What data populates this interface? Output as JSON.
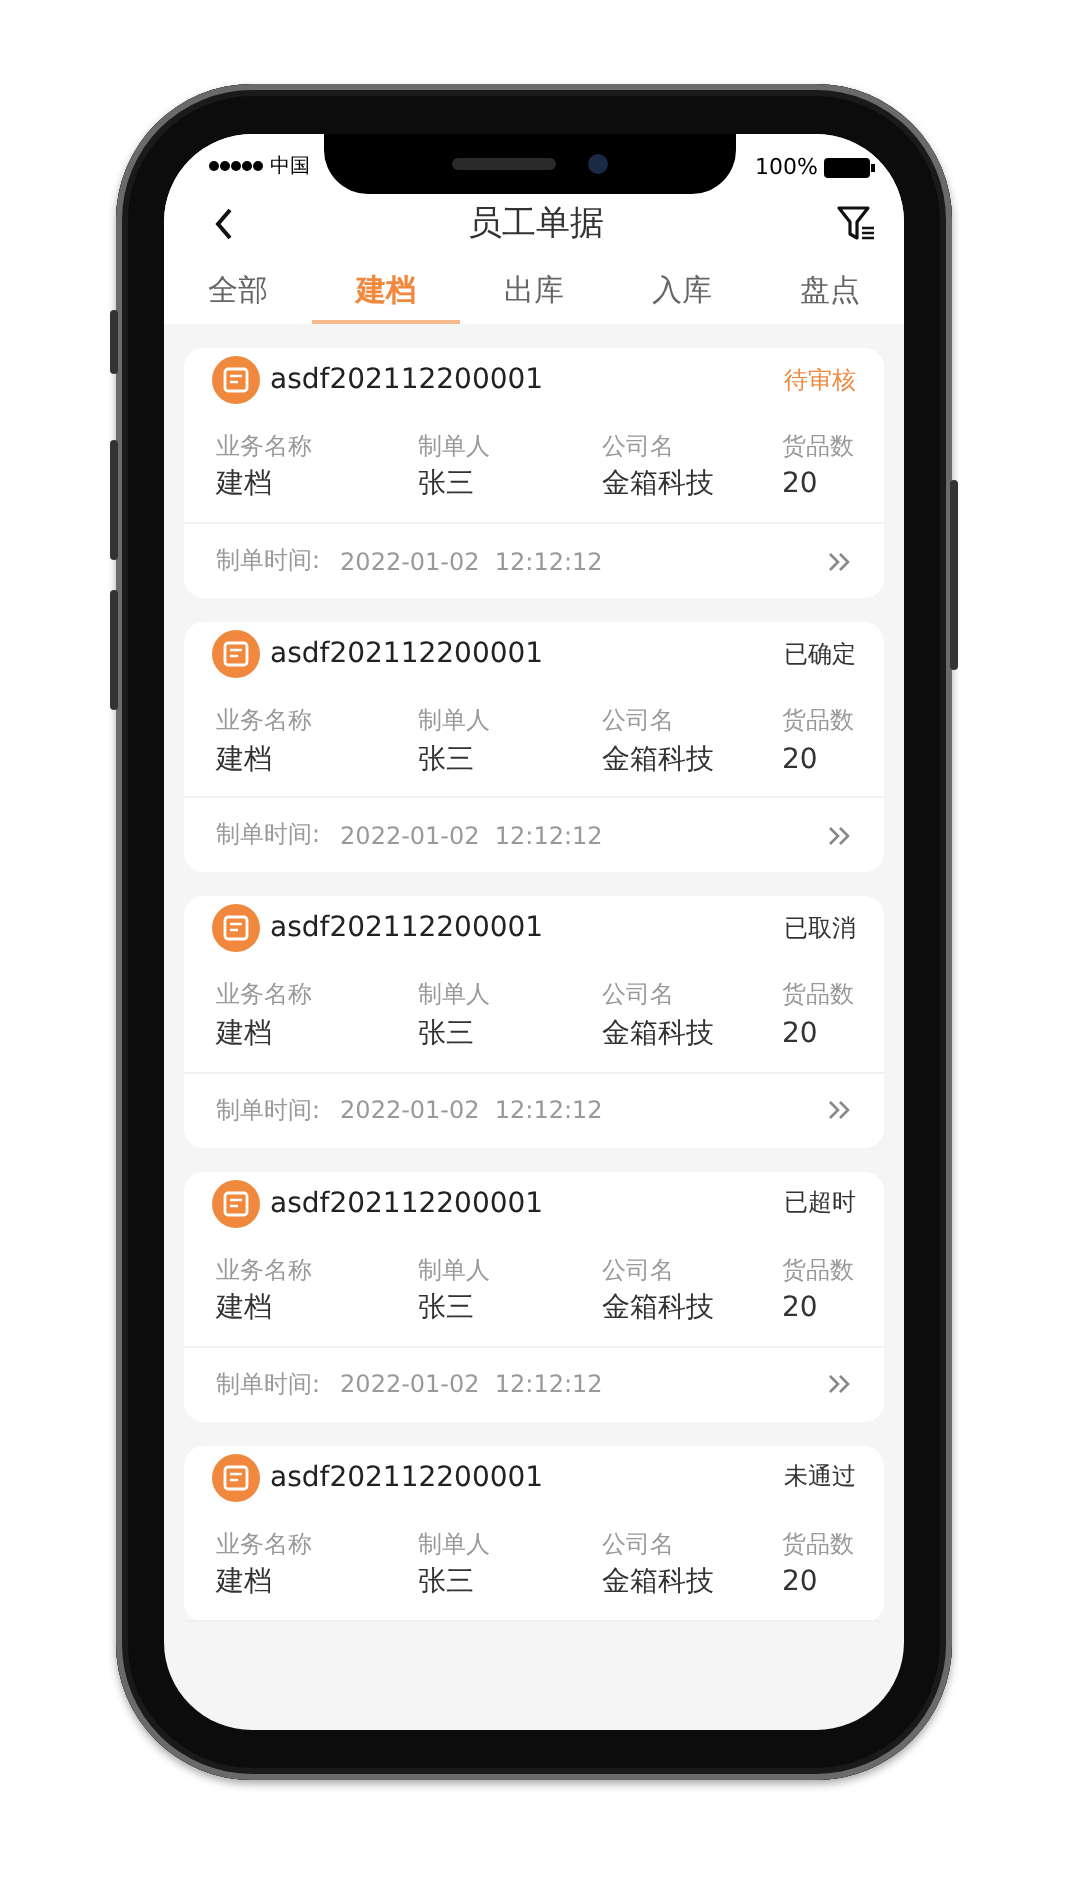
{
  "status_bar": {
    "carrier": "中国",
    "battery": "100%"
  },
  "nav": {
    "title": "员工单据"
  },
  "tabs": [
    {
      "label": "全部",
      "selected": false
    },
    {
      "label": "建档",
      "selected": true
    },
    {
      "label": "出库",
      "selected": false
    },
    {
      "label": "入库",
      "selected": false
    },
    {
      "label": "盘点",
      "selected": false
    }
  ],
  "cards": [
    {
      "number": "asdf202112200001",
      "status": "待审核",
      "color": "#f0883e",
      "labels": [
        "业务名称",
        "制单人",
        "公司名",
        "货品数"
      ],
      "values": [
        "建档",
        "张三",
        "金箱科技",
        "20"
      ],
      "time_label": "制单时间:",
      "time": "2022-01-02  12:12:12"
    },
    {
      "number": "asdf202112200001",
      "status": "已确定",
      "color": "#333333",
      "labels": [
        "业务名称",
        "制单人",
        "公司名",
        "货品数"
      ],
      "values": [
        "建档",
        "张三",
        "金箱科技",
        "20"
      ],
      "time_label": "制单时间:",
      "time": "2022-01-02  12:12:12"
    },
    {
      "number": "asdf202112200001",
      "status": "已取消",
      "color": "#333333",
      "labels": [
        "业务名称",
        "制单人",
        "公司名",
        "货品数"
      ],
      "values": [
        "建档",
        "张三",
        "金箱科技",
        "20"
      ],
      "time_label": "制单时间:",
      "time": "2022-01-02  12:12:12"
    },
    {
      "number": "asdf202112200001",
      "status": "已超时",
      "color": "#333333",
      "labels": [
        "业务名称",
        "制单人",
        "公司名",
        "货品数"
      ],
      "values": [
        "建档",
        "张三",
        "金箱科技",
        "20"
      ],
      "time_label": "制单时间:",
      "time": "2022-01-02  12:12:12"
    },
    {
      "number": "asdf202112200001",
      "status": "未通过",
      "color": "#333333",
      "labels": [
        "业务名称",
        "制单人",
        "公司名",
        "货品数"
      ],
      "values": [
        "建档",
        "张三",
        "金箱科技",
        "20"
      ]
    }
  ]
}
